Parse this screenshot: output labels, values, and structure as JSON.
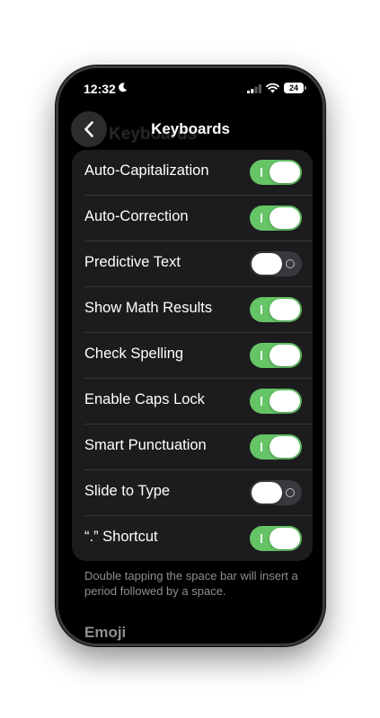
{
  "status_bar": {
    "time": "12:32",
    "battery": "24",
    "icons": [
      "moon-icon",
      "signal-icon",
      "wifi-icon",
      "battery-icon"
    ]
  },
  "nav": {
    "title": "Keyboards",
    "ghost_title": "Keyboards",
    "back_icon": "chevron-left-icon"
  },
  "settings": [
    {
      "label": "Auto-Capitalization",
      "on": true
    },
    {
      "label": "Auto-Correction",
      "on": true
    },
    {
      "label": "Predictive Text",
      "on": false
    },
    {
      "label": "Show Math Results",
      "on": true
    },
    {
      "label": "Check Spelling",
      "on": true
    },
    {
      "label": "Enable Caps Lock",
      "on": true
    },
    {
      "label": "Smart Punctuation",
      "on": true
    },
    {
      "label": "Slide to Type",
      "on": false
    },
    {
      "label": "“.” Shortcut",
      "on": true
    }
  ],
  "footnote": "Double tapping the space bar will insert a period followed by a space.",
  "next_section": "Emoji",
  "colors": {
    "toggle_on": "#65c466",
    "toggle_off": "#39393d",
    "group_background": "#1c1c1e",
    "secondary_text": "#8e8e93"
  }
}
